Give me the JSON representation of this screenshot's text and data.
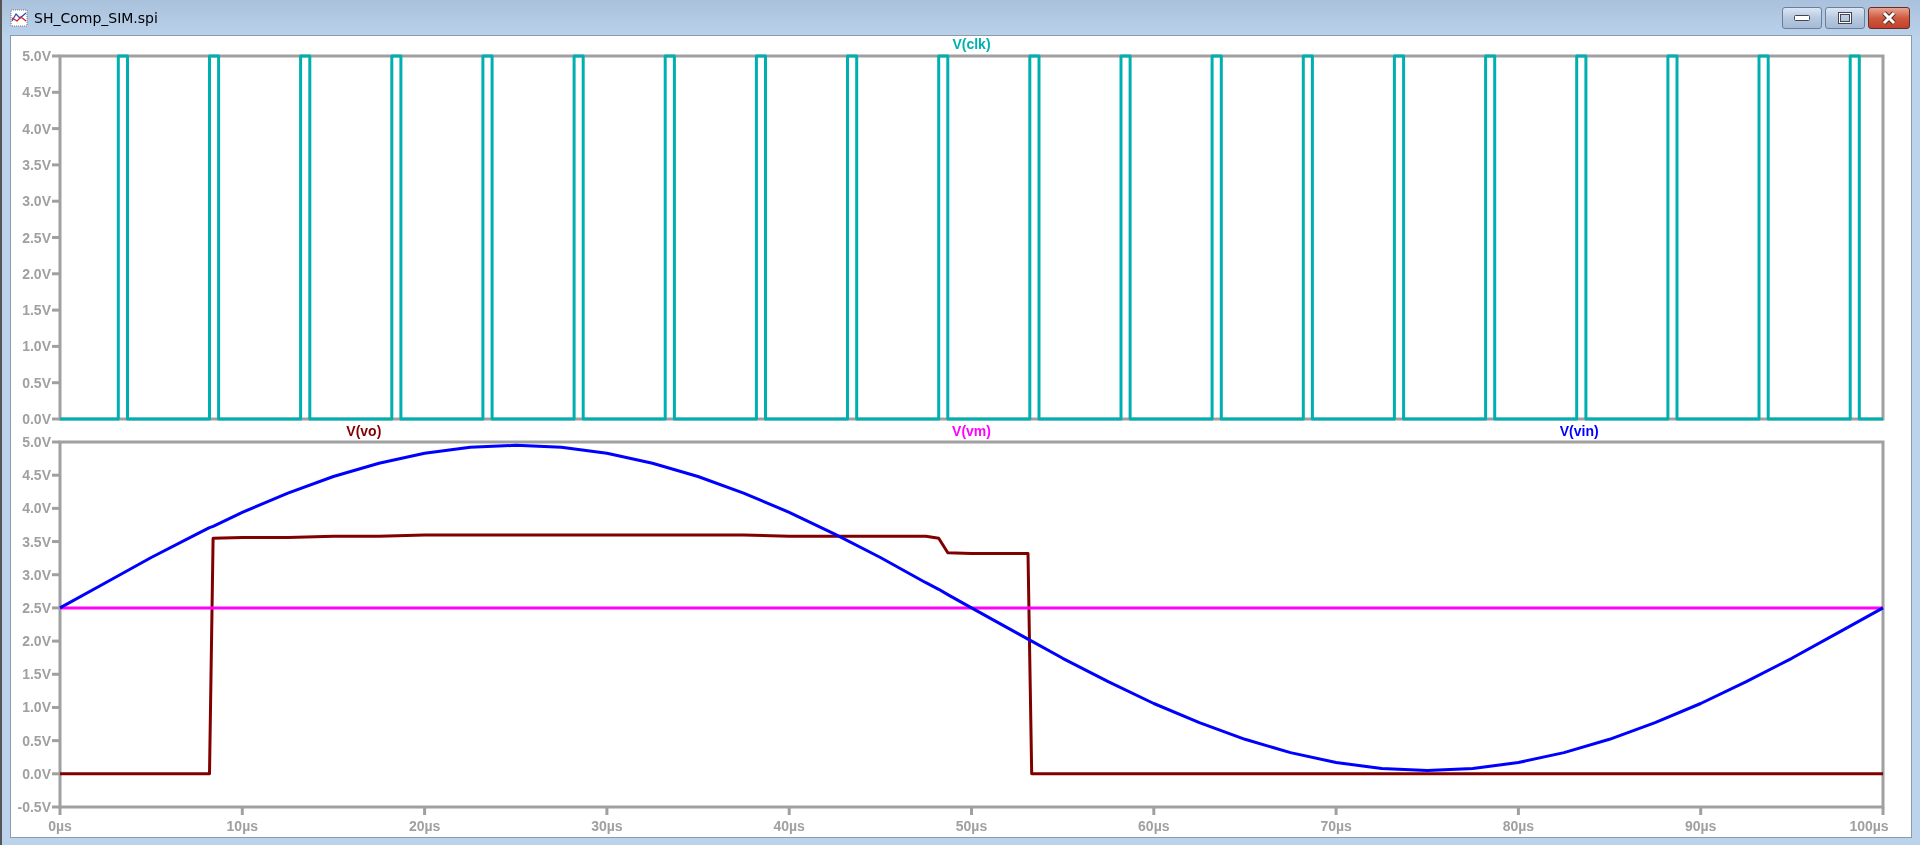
{
  "window": {
    "title": "SH_Comp_SIM.spi"
  },
  "panes": [
    {
      "chart_data": {
        "type": "line",
        "xlim": [
          0,
          100
        ],
        "ylim": [
          0,
          5
        ],
        "yticks": [
          {
            "value": 0,
            "label": "0.0V"
          },
          {
            "value": 0.5,
            "label": "0.5V"
          },
          {
            "value": 1,
            "label": "1.0V"
          },
          {
            "value": 1.5,
            "label": "1.5V"
          },
          {
            "value": 2,
            "label": "2.0V"
          },
          {
            "value": 2.5,
            "label": "2.5V"
          },
          {
            "value": 3,
            "label": "3.0V"
          },
          {
            "value": 3.5,
            "label": "3.5V"
          },
          {
            "value": 4,
            "label": "4.0V"
          },
          {
            "value": 4.5,
            "label": "4.5V"
          },
          {
            "value": 5,
            "label": "5.0V"
          }
        ],
        "x": [
          0,
          3.2,
          3.2,
          3.7,
          3.7,
          8.2,
          8.2,
          8.7,
          8.7,
          13.2,
          13.2,
          13.7,
          13.7,
          18.2,
          18.2,
          18.7,
          18.7,
          23.2,
          23.2,
          23.7,
          23.7,
          28.2,
          28.2,
          28.7,
          28.7,
          33.2,
          33.2,
          33.7,
          33.7,
          38.2,
          38.2,
          38.7,
          38.7,
          43.2,
          43.2,
          43.7,
          43.7,
          48.2,
          48.2,
          48.7,
          48.7,
          53.2,
          53.2,
          53.7,
          53.7,
          58.2,
          58.2,
          58.7,
          58.7,
          63.2,
          63.2,
          63.7,
          63.7,
          68.2,
          68.2,
          68.7,
          68.7,
          73.2,
          73.2,
          73.7,
          73.7,
          78.2,
          78.2,
          78.7,
          78.7,
          83.2,
          83.2,
          83.7,
          83.7,
          88.2,
          88.2,
          88.7,
          88.7,
          93.2,
          93.2,
          93.7,
          93.7,
          98.2,
          98.2,
          98.7,
          98.7,
          100
        ],
        "series": [
          {
            "name": "V(clk)",
            "color": "#00b0b0",
            "values": [
              0,
              0,
              5,
              5,
              0,
              0,
              5,
              5,
              0,
              0,
              5,
              5,
              0,
              0,
              5,
              5,
              0,
              0,
              5,
              5,
              0,
              0,
              5,
              5,
              0,
              0,
              5,
              5,
              0,
              0,
              5,
              5,
              0,
              0,
              5,
              5,
              0,
              0,
              5,
              5,
              0,
              0,
              5,
              5,
              0,
              0,
              5,
              5,
              0,
              0,
              5,
              5,
              0,
              0,
              5,
              5,
              0,
              0,
              5,
              5,
              0,
              0,
              5,
              5,
              0,
              0,
              5,
              5,
              0,
              0,
              5,
              5,
              0,
              0,
              5,
              5,
              0,
              0,
              5,
              5,
              0,
              0
            ]
          }
        ]
      }
    },
    {
      "chart_data": {
        "type": "line",
        "xlim": [
          0,
          100
        ],
        "ylim": [
          -0.5,
          5
        ],
        "yticks": [
          {
            "value": -0.5,
            "label": "-0.5V"
          },
          {
            "value": 0,
            "label": "0.0V"
          },
          {
            "value": 0.5,
            "label": "0.5V"
          },
          {
            "value": 1,
            "label": "1.0V"
          },
          {
            "value": 1.5,
            "label": "1.5V"
          },
          {
            "value": 2,
            "label": "2.0V"
          },
          {
            "value": 2.5,
            "label": "2.5V"
          },
          {
            "value": 3,
            "label": "3.0V"
          },
          {
            "value": 3.5,
            "label": "3.5V"
          },
          {
            "value": 4,
            "label": "4.0V"
          },
          {
            "value": 4.5,
            "label": "4.5V"
          },
          {
            "value": 5,
            "label": "5.0V"
          }
        ],
        "xticks": [
          {
            "value": 0,
            "label": "0µs"
          },
          {
            "value": 10,
            "label": "10µs"
          },
          {
            "value": 20,
            "label": "20µs"
          },
          {
            "value": 30,
            "label": "30µs"
          },
          {
            "value": 40,
            "label": "40µs"
          },
          {
            "value": 50,
            "label": "50µs"
          },
          {
            "value": 60,
            "label": "60µs"
          },
          {
            "value": 70,
            "label": "70µs"
          },
          {
            "value": 80,
            "label": "80µs"
          },
          {
            "value": 90,
            "label": "90µs"
          },
          {
            "value": 100,
            "label": "100µs"
          }
        ],
        "x": [
          0,
          2.5,
          5,
          7.5,
          8.2,
          8.4,
          10,
          12.5,
          15,
          17.5,
          20,
          22.5,
          25,
          27.5,
          30,
          32.5,
          35,
          37.5,
          40,
          42.5,
          45,
          47.5,
          48.2,
          48.7,
          50,
          52.5,
          53.1,
          53.3,
          55,
          57.5,
          60,
          62.5,
          65,
          67.5,
          70,
          72.5,
          75,
          77.5,
          80,
          82.5,
          85,
          87.5,
          90,
          92.5,
          95,
          97.5,
          100
        ],
        "series": [
          {
            "name": "V(vo)",
            "color": "#800000",
            "values": [
              0,
              0,
              0,
              0,
              0,
              3.55,
              3.56,
              3.56,
              3.58,
              3.58,
              3.6,
              3.6,
              3.6,
              3.6,
              3.6,
              3.6,
              3.6,
              3.6,
              3.58,
              3.58,
              3.58,
              3.58,
              3.55,
              3.33,
              3.32,
              3.32,
              3.32,
              0,
              0,
              0,
              0,
              0,
              0,
              0,
              0,
              0,
              0,
              0,
              0,
              0,
              0,
              0,
              0,
              0,
              0,
              0,
              0
            ]
          },
          {
            "name": "V(vm)",
            "color": "#ff00ff",
            "values": [
              2.5,
              2.5,
              2.5,
              2.5,
              2.5,
              2.5,
              2.5,
              2.5,
              2.5,
              2.5,
              2.5,
              2.5,
              2.5,
              2.5,
              2.5,
              2.5,
              2.5,
              2.5,
              2.5,
              2.5,
              2.5,
              2.5,
              2.5,
              2.5,
              2.5,
              2.5,
              2.5,
              2.5,
              2.5,
              2.5,
              2.5,
              2.5,
              2.5,
              2.5,
              2.5,
              2.5,
              2.5,
              2.5,
              2.5,
              2.5,
              2.5,
              2.5,
              2.5,
              2.5,
              2.5,
              2.5,
              2.5
            ]
          },
          {
            "name": "V(vin)",
            "color": "#0000ff",
            "values": [
              2.5,
              2.88,
              3.26,
              3.61,
              3.71,
              3.73,
              3.94,
              4.23,
              4.48,
              4.68,
              4.83,
              4.92,
              4.95,
              4.92,
              4.83,
              4.68,
              4.48,
              4.23,
              3.94,
              3.61,
              3.26,
              2.88,
              2.78,
              2.7,
              2.5,
              2.12,
              2.03,
              2.0,
              1.74,
              1.39,
              1.06,
              0.77,
              0.52,
              0.32,
              0.17,
              0.08,
              0.05,
              0.08,
              0.17,
              0.32,
              0.52,
              0.77,
              1.06,
              1.39,
              1.74,
              2.12,
              2.5
            ]
          }
        ]
      }
    }
  ]
}
